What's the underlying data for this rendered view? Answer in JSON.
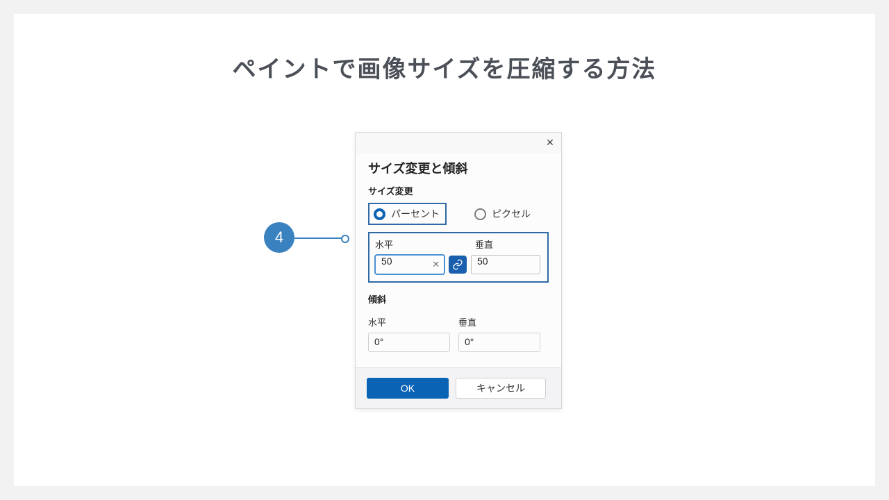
{
  "page": {
    "title": "ペイントで画像サイズを圧縮する方法",
    "step_number": "4"
  },
  "dialog": {
    "title": "サイズ変更と傾斜",
    "resize_section": "サイズ変更",
    "radio": {
      "percent": "パーセント",
      "pixel": "ピクセル"
    },
    "labels": {
      "horizontal": "水平",
      "vertical": "垂直"
    },
    "resize_values": {
      "horizontal": "50",
      "vertical": "50"
    },
    "skew_section": "傾斜",
    "skew_values": {
      "horizontal": "0°",
      "vertical": "0°"
    },
    "buttons": {
      "ok": "OK",
      "cancel": "キャンセル"
    }
  }
}
